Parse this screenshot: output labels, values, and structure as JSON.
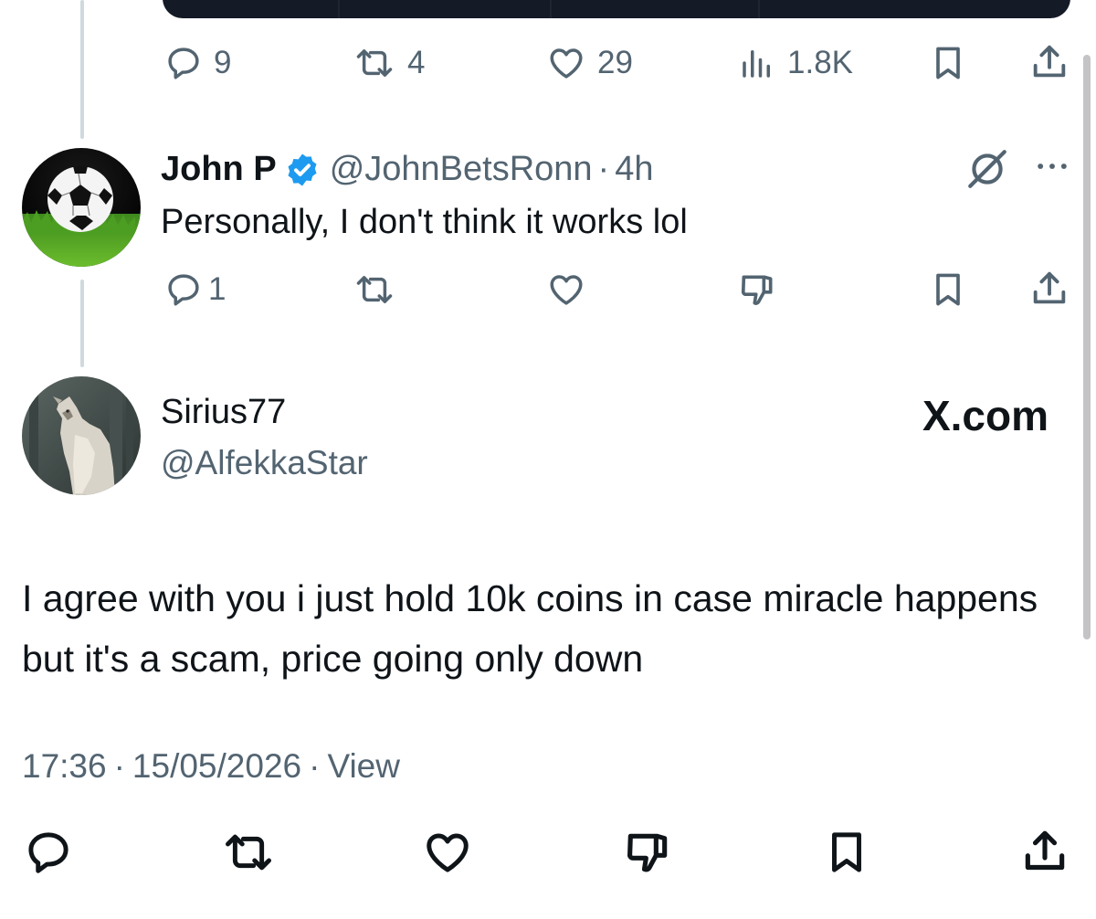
{
  "prev_tweet": {
    "actions": {
      "replies": "9",
      "reposts": "4",
      "likes": "29",
      "views": "1.8K"
    }
  },
  "reply_tweet": {
    "name": "John P",
    "handle": "@JohnBetsRonn",
    "separator": "·",
    "time": "4h",
    "text": "Personally, I don't think it works lol",
    "actions": {
      "replies": "1"
    },
    "verified_color": "#1d9bf0"
  },
  "main_tweet": {
    "name": "Sirius77",
    "handle": "@AlfekkaStar",
    "brand": "X.com",
    "text": "I agree with you i just hold 10k coins in case miracle happens but it's a scam, price going only down",
    "meta": {
      "time": "17:36",
      "separator": "·",
      "date": "15/05/2026",
      "view": "View"
    }
  },
  "icons": {
    "reply": "speech-bubble-icon",
    "repost": "repost-arrows-icon",
    "like": "heart-icon",
    "views": "bar-chart-icon",
    "bookmark": "bookmark-icon",
    "share": "share-upload-icon",
    "dislike": "thumbs-down-icon",
    "grok": "grok-slash-icon",
    "more": "more-dots-icon"
  }
}
